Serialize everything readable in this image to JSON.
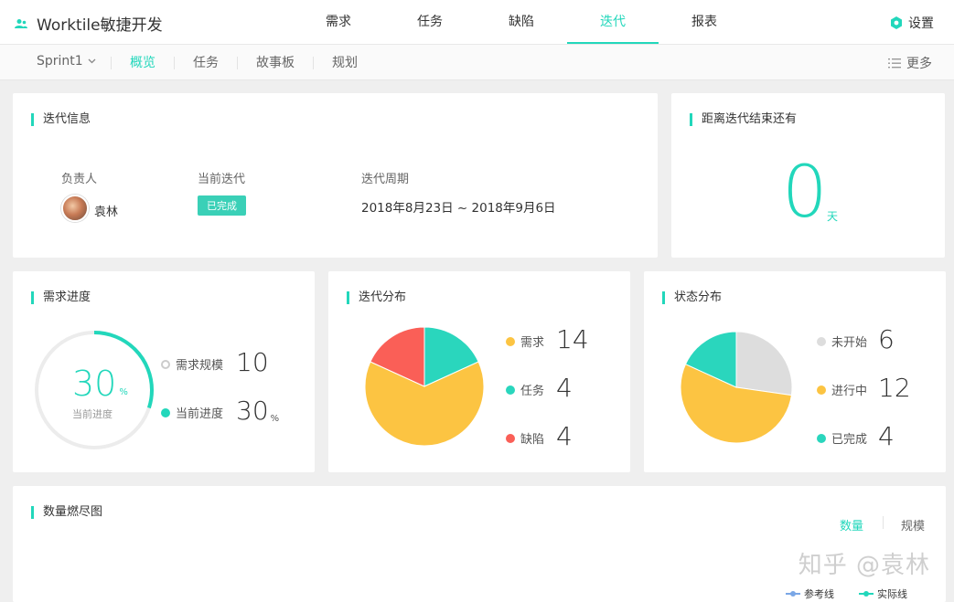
{
  "app": {
    "title": "Worktile敏捷开发"
  },
  "nav": {
    "items": [
      "需求",
      "任务",
      "缺陷",
      "迭代",
      "报表"
    ],
    "active": "迭代"
  },
  "settings": {
    "label": "设置"
  },
  "subnav": {
    "sprint": "Sprint1",
    "tabs": [
      "概览",
      "任务",
      "故事板",
      "规划"
    ],
    "active": "概览",
    "more": "更多"
  },
  "iteration_info": {
    "title": "迭代信息",
    "owner_label": "负责人",
    "owner_name": "袁林",
    "current_label": "当前迭代",
    "current_status": "已完成",
    "period_label": "迭代周期",
    "period_value": "2018年8月23日 ~ 2018年9月6日"
  },
  "countdown": {
    "title": "距离迭代结束还有",
    "value": "0",
    "unit": "天"
  },
  "requirement_progress": {
    "title": "需求进度",
    "percent": 30,
    "percent_text": "30",
    "percent_unit": "%",
    "center_label": "当前进度",
    "scale_label": "需求规模",
    "scale_value": "10",
    "progress_label": "当前进度",
    "progress_value": "30",
    "progress_unit": "%"
  },
  "iteration_distribution": {
    "title": "迭代分布",
    "items": [
      {
        "label": "需求",
        "value": 14,
        "value_text": "14",
        "color": "#fcc442"
      },
      {
        "label": "任务",
        "value": 4,
        "value_text": "4",
        "color": "#2ad6bd"
      },
      {
        "label": "缺陷",
        "value": 4,
        "value_text": "4",
        "color": "#fa5f57"
      }
    ]
  },
  "status_distribution": {
    "title": "状态分布",
    "items": [
      {
        "label": "未开始",
        "value": 6,
        "value_text": "6",
        "color": "#dddddd"
      },
      {
        "label": "进行中",
        "value": 12,
        "value_text": "12",
        "color": "#fcc442"
      },
      {
        "label": "已完成",
        "value": 4,
        "value_text": "4",
        "color": "#2ad6bd"
      }
    ]
  },
  "burndown": {
    "title": "数量燃尽图",
    "toggle": [
      "数量",
      "规模"
    ],
    "active": "数量",
    "legend_reference": "参考线",
    "legend_actual": "实际线",
    "reference_color": "#7aa7e6",
    "actual_color": "#22d7bb"
  },
  "watermark": "知乎 @袁林",
  "colors": {
    "accent": "#22d7bb"
  }
}
